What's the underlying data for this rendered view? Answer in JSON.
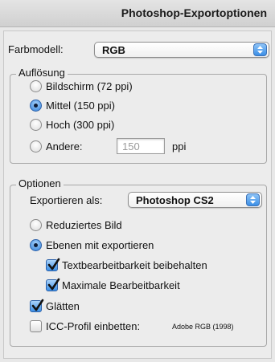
{
  "window": {
    "title": "Photoshop-Exportoptionen"
  },
  "color_model": {
    "label": "Farbmodell:",
    "value": "RGB"
  },
  "resolution": {
    "legend": "Auflösung",
    "options": [
      {
        "label": "Bildschirm (72 ppi)",
        "selected": false
      },
      {
        "label": "Mittel (150 ppi)",
        "selected": true
      },
      {
        "label": "Hoch (300 ppi)",
        "selected": false
      },
      {
        "label": "Andere:",
        "selected": false
      }
    ],
    "other_placeholder": "150",
    "unit": "ppi"
  },
  "options": {
    "legend": "Optionen",
    "export_as_label": "Exportieren als:",
    "export_as_value": "Photoshop CS2",
    "flat_image": {
      "label": "Reduziertes Bild",
      "selected": false
    },
    "with_layers": {
      "label": "Ebenen mit exportieren",
      "selected": true
    },
    "keep_text_editable": {
      "label": "Textbearbeitbarkeit beibehalten",
      "checked": true
    },
    "max_editability": {
      "label": "Maximale Bearbeitbarkeit",
      "checked": true
    },
    "antialias": {
      "label": "Glätten",
      "checked": true
    },
    "icc_profile": {
      "label": "ICC-Profil einbetten:",
      "checked": false,
      "profile_name": "Adobe RGB (1998)"
    }
  },
  "colors": {
    "accent": "#3b8fe6",
    "background": "#ececec"
  }
}
